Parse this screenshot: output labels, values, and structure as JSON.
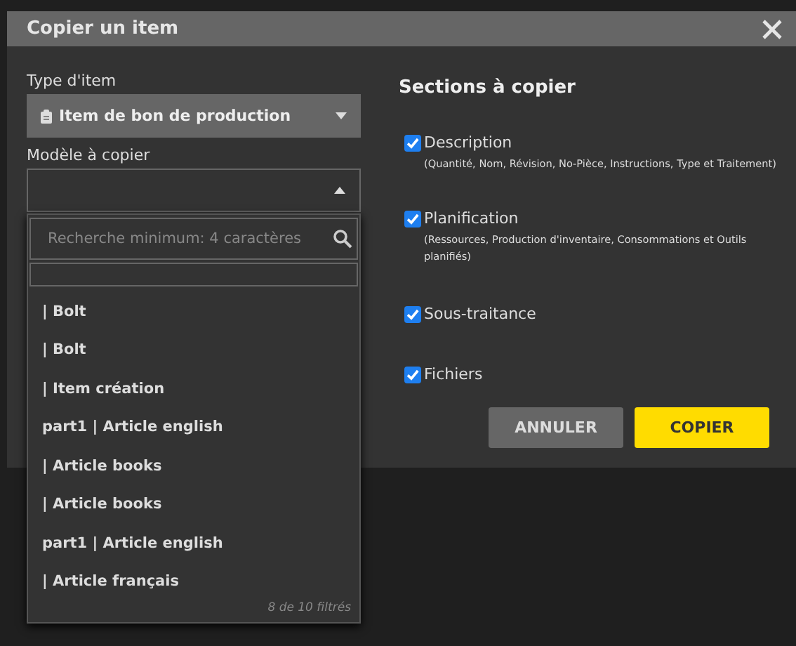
{
  "dialog": {
    "title": "Copier un item"
  },
  "item_type": {
    "label": "Type d'item",
    "value": "Item de bon de production"
  },
  "template": {
    "label": "Modèle à copier",
    "expanded": true,
    "search_placeholder": "Recherche minimum: 4 caractères",
    "items": [
      "| Bolt",
      "| Bolt",
      "| Item création",
      "part1 | Article english",
      "| Article books",
      "| Article books",
      "part1 | Article english",
      "| Article français"
    ],
    "footer": "8 de 10 filtrés"
  },
  "sections": {
    "title": "Sections à copier",
    "options": [
      {
        "label": "Description",
        "note": "(Quantité, Nom, Révision, No-Pièce, Instructions, Type et Traitement)",
        "checked": true
      },
      {
        "label": "Planification",
        "note": "(Ressources, Production d'inventaire, Consommations et Outils planifiés)",
        "checked": true
      },
      {
        "label": "Sous-traitance",
        "checked": true
      },
      {
        "label": "Fichiers",
        "checked": true
      }
    ]
  },
  "buttons": [
    {
      "label": "ANNULER",
      "kind": "secondary"
    },
    {
      "label": "COPIER",
      "kind": "primary"
    }
  ]
}
